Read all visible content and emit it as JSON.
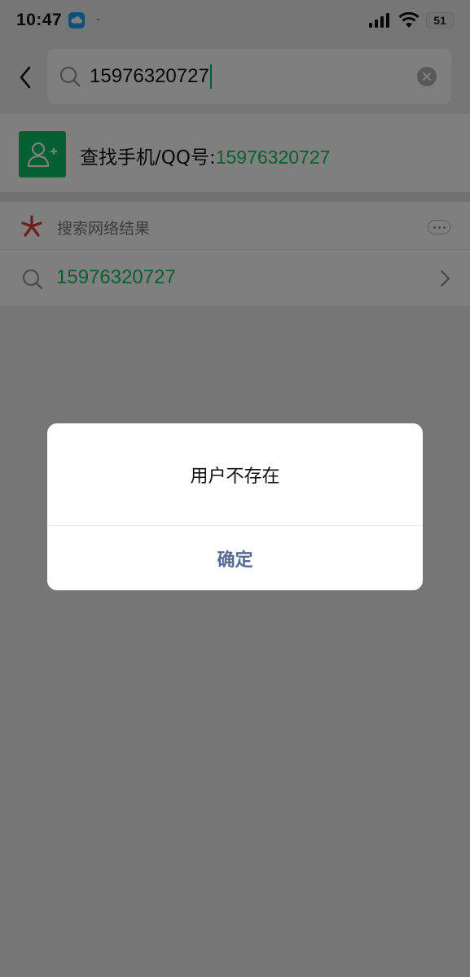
{
  "status_bar": {
    "time": "10:47",
    "dot": "·",
    "battery": "51",
    "icons": [
      "cloud-icon",
      "signal-icon",
      "wifi-icon",
      "battery-icon"
    ]
  },
  "search": {
    "query": "15976320727",
    "icons": [
      "back-arrow-icon",
      "search-icon",
      "clear-icon"
    ]
  },
  "find_contact": {
    "label": "查找手机/QQ号:",
    "number": "15976320727",
    "icon": "add-friend-icon"
  },
  "network_results": {
    "title": "搜索网络结果",
    "query": "15976320727",
    "icons": [
      "search-logo-icon",
      "more-icon",
      "search-icon",
      "chevron-right-icon"
    ]
  },
  "dialog": {
    "message": "用户不存在",
    "confirm_label": "确定"
  },
  "colors": {
    "accent_green": "#07c160",
    "dialog_button": "#576b95",
    "background": "#ededed"
  }
}
